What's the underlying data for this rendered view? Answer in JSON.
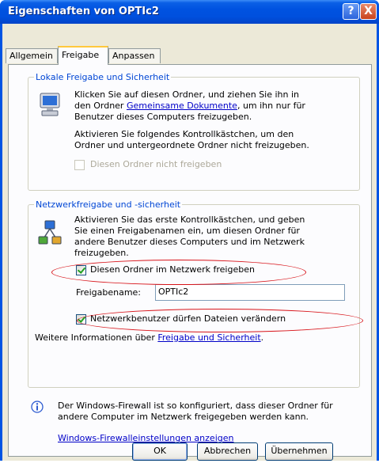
{
  "window": {
    "title": "Eigenschaften von OPTIc2",
    "help_symbol": "?",
    "close_symbol": "X"
  },
  "tabs": [
    {
      "label": "Allgemein"
    },
    {
      "label": "Freigabe"
    },
    {
      "label": "Anpassen"
    }
  ],
  "local_section": {
    "title": "Lokale Freigabe und Sicherheit",
    "line1": "Klicken Sie auf diesen Ordner, und ziehen Sie ihn in",
    "line2_pre": "den Ordner ",
    "line2_link": "Gemeinsame Dokumente",
    "line2_post": ", um ihn nur für",
    "line3": "Benutzer dieses Computers freizugeben.",
    "line4": "Aktivieren Sie folgendes Kontrollkästchen, um den",
    "line5": "Ordner und untergeordnete Ordner nicht freizugeben.",
    "no_share_label": "Diesen Ordner nicht freigeben"
  },
  "network_section": {
    "title": "Netzwerkfreigabe und -sicherheit",
    "line1": "Aktivieren Sie das erste Kontrollkästchen, und geben",
    "line2": "Sie einen Freigabenamen ein, um diesen Ordner für",
    "line3": "andere Benutzer dieses Computers und im Netzwerk",
    "line4": "freizugeben.",
    "share_checkbox_label": "Diesen Ordner im Netzwerk freigeben",
    "share_name_label": "Freigabename:",
    "share_name_value": "OPTIc2",
    "allow_change_label": "Netzwerkbenutzer dürfen Dateien verändern",
    "more_info_pre": "Weitere Informationen über ",
    "more_info_link": "Freigabe und Sicherheit",
    "more_info_post": "."
  },
  "firewall": {
    "line1": "Der Windows-Firewall ist so konfiguriert, dass dieser Ordner für",
    "line2": "andere Computer im Netzwerk freigegeben werden kann.",
    "settings_link": "Windows-Firewalleinstellungen anzeigen"
  },
  "buttons": {
    "ok": "OK",
    "cancel": "Abbrechen",
    "apply": "Übernehmen"
  },
  "states": {
    "no_share_checked": false,
    "no_share_enabled": false,
    "share_checked": true,
    "allow_change_checked": true
  },
  "colors": {
    "titlebar": "#0054e3",
    "dialog_bg": "#ece9d8",
    "link": "#0000c8",
    "group_title": "#0046d5",
    "highlight_ellipse": "#d8141a",
    "active_tab_accent": "#ffc83c"
  }
}
